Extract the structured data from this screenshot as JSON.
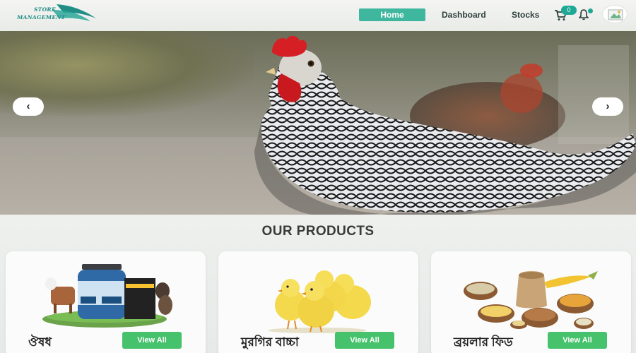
{
  "navbar": {
    "logo": {
      "line1": "STORE",
      "line2": "MANAGEMENT"
    },
    "home_label": "Home",
    "dashboard_label": "Dashboard",
    "stocks_label": "Stocks",
    "cart_count": "0",
    "icons": {
      "cart": "cart-icon",
      "bell": "bell-icon",
      "avatar": "avatar-image"
    }
  },
  "hero": {
    "prev_label": "‹",
    "next_label": "›"
  },
  "products": {
    "title": "OUR PRODUCTS",
    "cards": [
      {
        "title": "ঔষধ",
        "button": "View All"
      },
      {
        "title": "মুরগির বাচ্চা",
        "button": "View All"
      },
      {
        "title": "ব্রয়লার ফিড",
        "button": "View All"
      }
    ]
  },
  "colors": {
    "accent": "#3fb69e",
    "button_green": "#46c26c",
    "badge": "#1ea895"
  }
}
